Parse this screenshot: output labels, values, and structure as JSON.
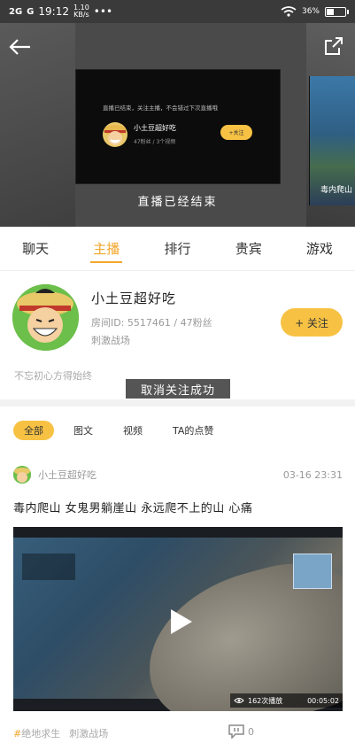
{
  "status_bar": {
    "network": "2G",
    "carrier_g": "G",
    "time": "19:12",
    "speed_value": "1.10",
    "speed_unit": "KB/s",
    "more": "•••",
    "battery_percent": "36%",
    "battery_level": 0.36
  },
  "hero": {
    "ended_card": {
      "note": "直播已结束，关注主播，不会错过下次直播哦",
      "name": "小土豆超好吃",
      "stats": "47粉丝 / 3个视频",
      "follow_label": "+关注"
    },
    "right_thumb_text": "毒内爬山",
    "ended_text": "直播已经结束"
  },
  "tabs": [
    {
      "label": "聊天",
      "active": false
    },
    {
      "label": "主播",
      "active": true
    },
    {
      "label": "排行",
      "active": false
    },
    {
      "label": "贵宾",
      "active": false
    },
    {
      "label": "游戏",
      "active": false
    }
  ],
  "profile": {
    "name": "小土豆超好吃",
    "room_info": "房间ID: 5517461 / 47粉丝",
    "game": "刺激战场",
    "follow_label": "+ 关注",
    "bio": "不忘初心方得始终"
  },
  "toast": "取消关注成功",
  "filters": [
    {
      "label": "全部",
      "active": true
    },
    {
      "label": "图文",
      "active": false
    },
    {
      "label": "视频",
      "active": false
    },
    {
      "label": "TA的点赞",
      "active": false
    }
  ],
  "post": {
    "author": "小土豆超好吃",
    "time": "03-16 23:31",
    "title": "毒内爬山 女鬼男躺崖山 永远爬不上的山 心痛",
    "views": "162次播放",
    "duration": "00:05:02",
    "tag1_hash": "#",
    "tag1": "绝地求生",
    "tag2": "刺激战场",
    "comments": "0"
  },
  "colors": {
    "accent": "#f1a72e",
    "button": "#f7c244"
  }
}
